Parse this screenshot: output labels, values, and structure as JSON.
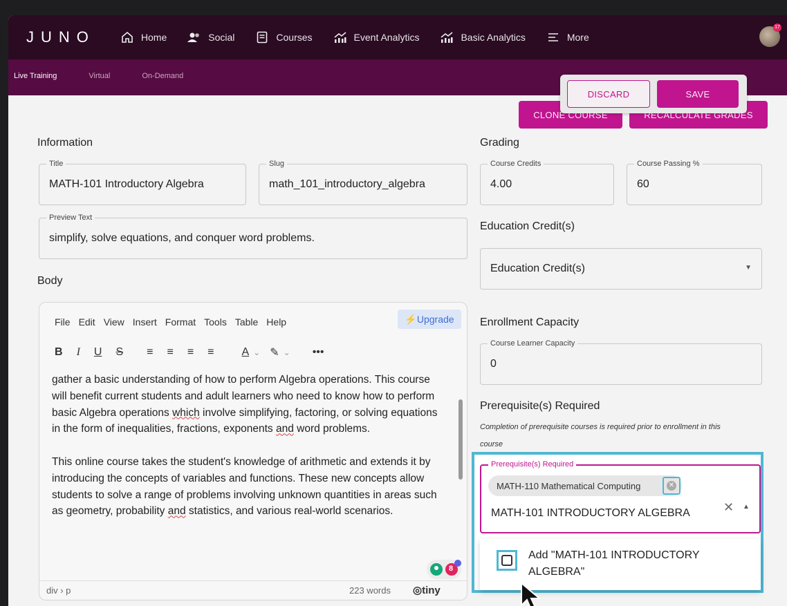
{
  "app": {
    "logo": "JUNO"
  },
  "nav": {
    "items": [
      {
        "label": "Home",
        "icon": "home-icon"
      },
      {
        "label": "Social",
        "icon": "people-icon"
      },
      {
        "label": "Courses",
        "icon": "book-icon"
      },
      {
        "label": "Event Analytics",
        "icon": "chart-icon"
      },
      {
        "label": "Basic Analytics",
        "icon": "chart-icon"
      },
      {
        "label": "More",
        "icon": "menu-icon"
      }
    ],
    "avatar_badge": "17"
  },
  "subnav": {
    "tabs": [
      "Live Training",
      "Virtual",
      "On-Demand"
    ],
    "active": "Live Training"
  },
  "actions": {
    "discard": "DISCARD",
    "save": "SAVE",
    "clone": "CLONE COURSE",
    "recalculate": "RECALCULATE GRADES"
  },
  "information": {
    "heading": "Information",
    "title_label": "Title",
    "title_value": "MATH-101 Introductory Algebra",
    "slug_label": "Slug",
    "slug_value": "math_101_introductory_algebra",
    "preview_label": "Preview Text",
    "preview_value": "simplify, solve equations, and conquer word problems."
  },
  "body": {
    "heading": "Body",
    "menu": [
      "File",
      "Edit",
      "View",
      "Insert",
      "Format",
      "Tools",
      "Table",
      "Help"
    ],
    "upgrade": "⚡Upgrade",
    "toolbar": [
      "B",
      "I",
      "U",
      "S",
      "≡",
      "≡",
      "≡",
      "≡",
      "A",
      "✎",
      "•••"
    ],
    "paragraph1_a": "gather a basic understanding of how to perform Algebra operations. This course will benefit current students and adult learners who need to know how to perform basic Algebra operations ",
    "paragraph1_which": "which",
    "paragraph1_b": " involve simplifying, factoring, or solving equations in the form of inequalities, fractions, exponents ",
    "paragraph1_and": "and",
    "paragraph1_c": " word problems.",
    "paragraph2_a": "This online course takes the student's knowledge of arithmetic and extends it by introducing the concepts of variables and functions. These new concepts allow students to solve a range of problems involving unknown quantities in areas such as geometry, probability ",
    "paragraph2_and": "and",
    "paragraph2_b": " statistics, and various real-world scenarios.",
    "status_path": "div › p",
    "word_count": "223 words",
    "brand": "tiny",
    "grammarly_count": "8"
  },
  "grading": {
    "heading": "Grading",
    "credits_label": "Course Credits",
    "credits_value": "4.00",
    "passing_label": "Course Passing %",
    "passing_value": "60"
  },
  "education": {
    "heading": "Education Credit(s)",
    "select_value": "Education Credit(s)"
  },
  "enrollment": {
    "heading": "Enrollment Capacity",
    "capacity_label": "Course Learner Capacity",
    "capacity_value": "0"
  },
  "prerequisites": {
    "heading": "Prerequisite(s) Required",
    "note": "Completion of prerequisite courses is required prior to enrollment in this course",
    "field_label": "Prerequisite(s) Required",
    "chip": "MATH-110 Mathematical Computing",
    "input_value": "MATH-101 INTRODUCTORY  ALGEBRA",
    "option": "Add \"MATH-101 INTRODUCTORY ALGEBRA\""
  },
  "colors": {
    "nav": "#2a0b22",
    "subnav": "#560b42",
    "accent": "#c0158f",
    "focus": "#4fb8d3"
  }
}
